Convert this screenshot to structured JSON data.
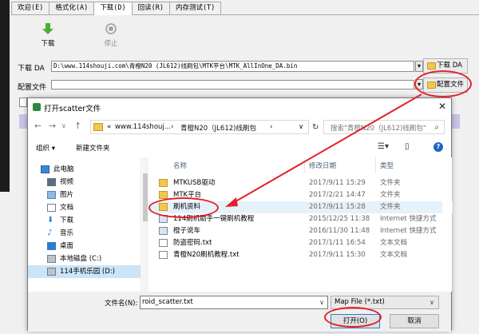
{
  "tabs": [
    "欢迎(E)",
    "格式化(A)",
    "下载(D)",
    "回读(R)",
    "内存测试(T)"
  ],
  "active_tab_index": 2,
  "toolbar": {
    "download": "下载",
    "stop": "停止"
  },
  "download_da": {
    "label": "下载 DA",
    "path": "D:\\www.114shouji.com\\青橙N20 (JL612)线刷包\\MTK平台\\MTK_AllInOne_DA.bin",
    "button": "下载 DA"
  },
  "config": {
    "label": "配置文件",
    "button": "配置文件"
  },
  "dialog": {
    "title": "打开scatter文件",
    "address": {
      "root": "www.114shouj...",
      "folder": "青橙N20（JL612)线刷包"
    },
    "search_placeholder": "搜索\"青橙N20（JL612)线刷包\"",
    "commands": {
      "organize": "组织",
      "new_folder": "新建文件夹"
    },
    "nav": [
      {
        "label": "此电脑",
        "icon": "pc-icon"
      },
      {
        "label": "视频",
        "icon": "video-icon"
      },
      {
        "label": "图片",
        "icon": "picture-icon"
      },
      {
        "label": "文档",
        "icon": "document-icon"
      },
      {
        "label": "下载",
        "icon": "download-icon"
      },
      {
        "label": "音乐",
        "icon": "music-icon"
      },
      {
        "label": "桌面",
        "icon": "desktop-icon"
      },
      {
        "label": "本地磁盘 (C:)",
        "icon": "drive-icon"
      },
      {
        "label": "114手机乐园 (D:)",
        "icon": "drive-icon"
      }
    ],
    "columns": {
      "name": "名称",
      "date": "修改日期",
      "type": "类型"
    },
    "files": [
      {
        "name": "MTKUSB驱动",
        "date": "2017/9/11 15:29",
        "type": "文件夹",
        "kind": "folder"
      },
      {
        "name": "MTK平台",
        "date": "2017/2/21 14:47",
        "type": "文件夹",
        "kind": "folder"
      },
      {
        "name": "刷机资料",
        "date": "2017/9/11 15:28",
        "type": "文件夹",
        "kind": "folder"
      },
      {
        "name": "114刷机助手一键刷机教程",
        "date": "2015/12/25 11:38",
        "type": "Internet 快捷方式",
        "kind": "link"
      },
      {
        "name": "橙子说车",
        "date": "2016/11/30 11:48",
        "type": "Internet 快捷方式",
        "kind": "link"
      },
      {
        "name": "防盗密码.txt",
        "date": "2017/1/11 16:54",
        "type": "文本文档",
        "kind": "txt"
      },
      {
        "name": "青橙N20刷机教程.txt",
        "date": "2017/9/11 15:30",
        "type": "文本文档",
        "kind": "txt"
      }
    ],
    "filename_label": "文件名(N):",
    "filename_value": "roid_scatter.txt",
    "filter": "Map File (*.txt)",
    "open_button": "打开(O)",
    "cancel_button": "取消"
  },
  "colors": {
    "highlight_red": "#e2222a",
    "selection_blue": "#cce4f7",
    "folder_yellow": "#f3c64e"
  }
}
